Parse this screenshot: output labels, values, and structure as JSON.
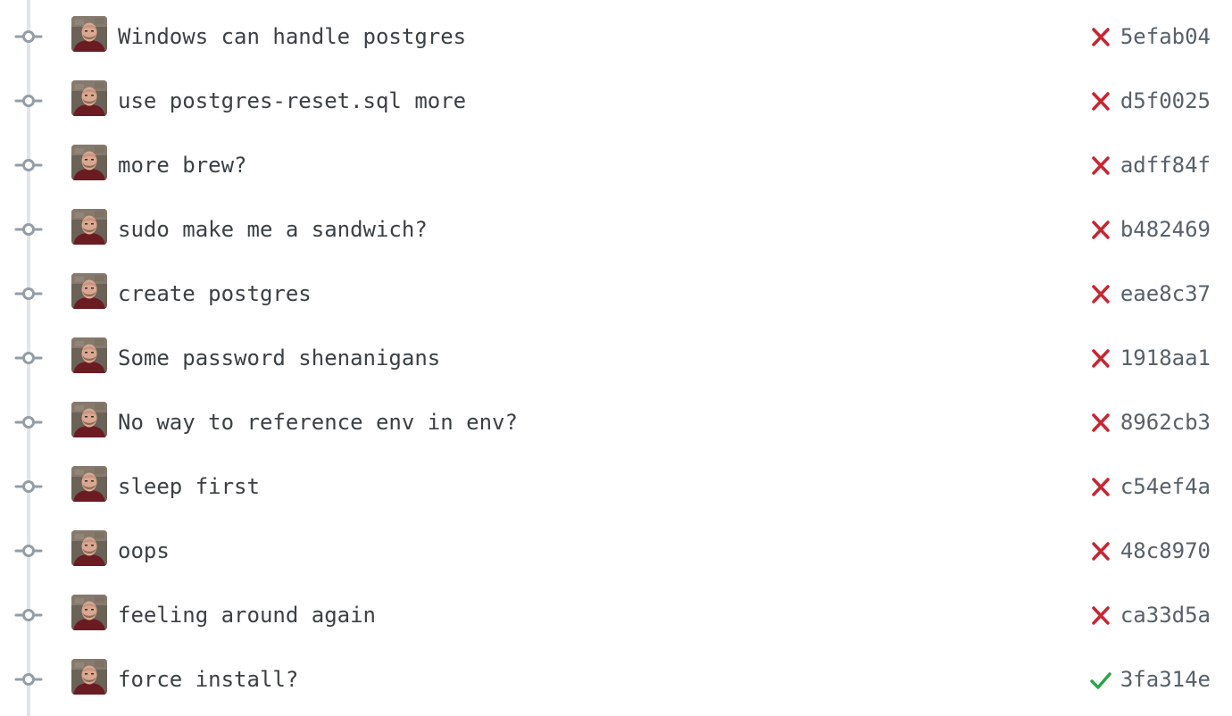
{
  "colors": {
    "failure": "#cb2431",
    "success": "#28a745",
    "timeline": "#e1e4e8",
    "node": "#959da5",
    "message": "#3b4045",
    "sha": "#586069"
  },
  "commits": [
    {
      "message": "Windows can handle postgres",
      "sha": "5efab04",
      "status": "failure",
      "status_icon": "x-icon",
      "avatar_icon": "author-avatar"
    },
    {
      "message": "use postgres-reset.sql more",
      "sha": "d5f0025",
      "status": "failure",
      "status_icon": "x-icon",
      "avatar_icon": "author-avatar"
    },
    {
      "message": "more brew?",
      "sha": "adff84f",
      "status": "failure",
      "status_icon": "x-icon",
      "avatar_icon": "author-avatar"
    },
    {
      "message": "sudo make me a sandwich?",
      "sha": "b482469",
      "status": "failure",
      "status_icon": "x-icon",
      "avatar_icon": "author-avatar"
    },
    {
      "message": "create postgres",
      "sha": "eae8c37",
      "status": "failure",
      "status_icon": "x-icon",
      "avatar_icon": "author-avatar"
    },
    {
      "message": "Some password shenanigans",
      "sha": "1918aa1",
      "status": "failure",
      "status_icon": "x-icon",
      "avatar_icon": "author-avatar"
    },
    {
      "message": "No way to reference env in env?",
      "sha": "8962cb3",
      "status": "failure",
      "status_icon": "x-icon",
      "avatar_icon": "author-avatar"
    },
    {
      "message": "sleep first",
      "sha": "c54ef4a",
      "status": "failure",
      "status_icon": "x-icon",
      "avatar_icon": "author-avatar"
    },
    {
      "message": "oops",
      "sha": "48c8970",
      "status": "failure",
      "status_icon": "x-icon",
      "avatar_icon": "author-avatar"
    },
    {
      "message": "feeling around again",
      "sha": "ca33d5a",
      "status": "failure",
      "status_icon": "x-icon",
      "avatar_icon": "author-avatar"
    },
    {
      "message": "force install?",
      "sha": "3fa314e",
      "status": "success",
      "status_icon": "check-icon",
      "avatar_icon": "author-avatar"
    }
  ]
}
